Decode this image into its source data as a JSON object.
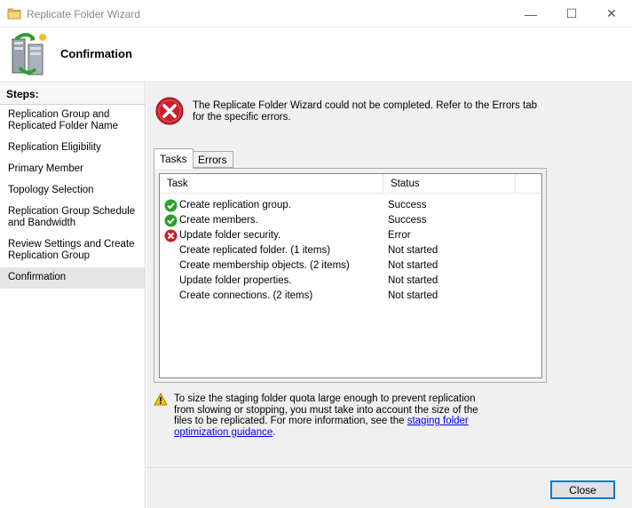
{
  "window": {
    "title": "Replicate Folder Wizard",
    "min_glyph": "—",
    "max_glyph": "☐",
    "close_glyph": "✕"
  },
  "header": {
    "title": "Confirmation"
  },
  "sidebar": {
    "header": "Steps:",
    "items": [
      {
        "label": "Replication Group and Replicated Folder Name"
      },
      {
        "label": "Replication Eligibility"
      },
      {
        "label": "Primary Member"
      },
      {
        "label": "Topology Selection"
      },
      {
        "label": "Replication Group Schedule and Bandwidth"
      },
      {
        "label": "Review Settings and Create Replication Group"
      },
      {
        "label": "Confirmation"
      }
    ],
    "active_index": 6
  },
  "main": {
    "error_message": "The Replicate Folder Wizard could not be completed. Refer to the Errors tab for the specific errors.",
    "tabs": [
      {
        "label": "Tasks"
      },
      {
        "label": "Errors"
      }
    ],
    "table": {
      "columns": [
        "Task",
        "Status"
      ],
      "rows": [
        {
          "task": "Create replication group.",
          "status": "Success",
          "icon": "success-icon"
        },
        {
          "task": "Create members.",
          "status": "Success",
          "icon": "success-icon"
        },
        {
          "task": "Update folder security.",
          "status": "Error",
          "icon": "error-icon"
        },
        {
          "task": "Create replicated folder. (1 items)",
          "status": "Not started",
          "icon": ""
        },
        {
          "task": "Create membership objects. (2 items)",
          "status": "Not started",
          "icon": ""
        },
        {
          "task": "Update folder properties.",
          "status": "Not started",
          "icon": ""
        },
        {
          "task": "Create connections. (2 items)",
          "status": "Not started",
          "icon": ""
        }
      ]
    },
    "warning": {
      "text": "To size the staging folder quota large enough to prevent replication from slowing or stopping, you must take into account the size of the files to be replicated. For more information, see the ",
      "link": "staging folder optimization guidance",
      "suffix": "."
    }
  },
  "footer": {
    "close_label": "Close"
  },
  "colors": {
    "success": "#2e9e2e",
    "error": "#c8202a",
    "warning": "#f4c400",
    "link": "#0000ee",
    "accent": "#0078d7"
  }
}
